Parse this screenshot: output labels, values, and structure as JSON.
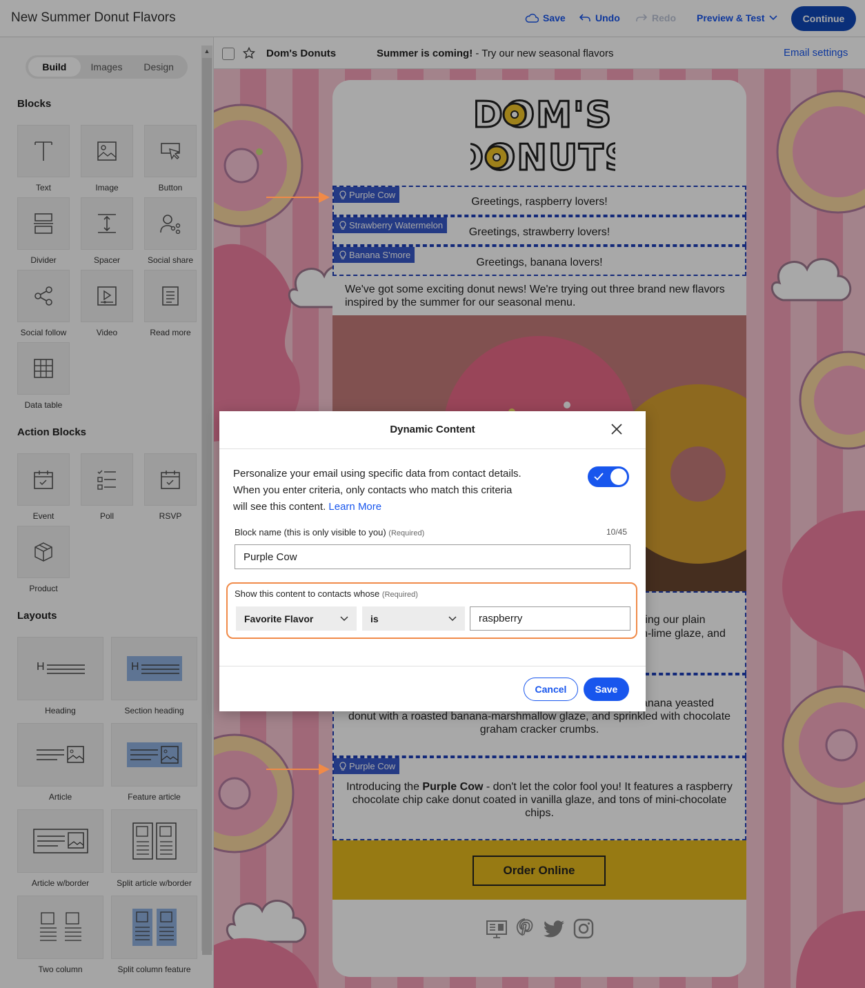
{
  "header": {
    "title": "New Summer Donut Flavors",
    "save": "Save",
    "undo": "Undo",
    "redo": "Redo",
    "preview": "Preview & Test",
    "continue": "Continue"
  },
  "sidebar": {
    "tabs": [
      "Build",
      "Images",
      "Design"
    ],
    "blocks_title": "Blocks",
    "blocks": [
      "Text",
      "Image",
      "Button",
      "Divider",
      "Spacer",
      "Social share",
      "Social follow",
      "Video",
      "Read more",
      "Data table"
    ],
    "action_title": "Action Blocks",
    "action_blocks": [
      "Event",
      "Poll",
      "RSVP",
      "Product"
    ],
    "layouts_title": "Layouts",
    "layouts": [
      "Heading",
      "Section heading",
      "Article",
      "Feature article",
      "Article w/border",
      "Split article w/border",
      "Two column",
      "Split column feature"
    ]
  },
  "subject_bar": {
    "sender": "Dom's Donuts",
    "subject_bold": "Summer is coming!",
    "subject_rest": " - Try our new seasonal flavors",
    "settings": "Email settings"
  },
  "email": {
    "logo_line1": "DOM'S",
    "logo_line2": "DONUTS",
    "greetings": [
      {
        "tag": "Purple Cow",
        "text": "Greetings, raspberry lovers!"
      },
      {
        "tag": "Strawberry Watermelon",
        "text": "Greetings, strawberry lovers!"
      },
      {
        "tag": "Banana S'more",
        "text": "Greetings, banana lovers!"
      }
    ],
    "intro": "We've got some exciting donut news! We're trying out three brand new flavors inspired by the summer for our seasonal menu.",
    "partial_line1": "ring our plain",
    "partial_line2": "n-lime glaze, and",
    "banana_desc_line1": "anana yeasted",
    "banana_desc_rest": "donut with a roasted banana-marshmallow glaze, and sprinkled with chocolate graham cracker crumbs.",
    "purple_tag": "Purple Cow",
    "purple_pre": "Introducing the ",
    "purple_bold": "Purple Cow",
    "purple_rest": " - don't let the color fool you! It features a raspberry chocolate chip cake donut coated in vanilla glaze, and tons of mini-chocolate chips.",
    "order_button": "Order Online"
  },
  "modal": {
    "title": "Dynamic Content",
    "description": "Personalize your email using specific data from contact details. When you enter criteria, only contacts who match this criteria will see this content.",
    "learn_more": "Learn More",
    "toggle_on": true,
    "name_label": "Block name (this is only visible to you)",
    "required": "(Required)",
    "char_count": "10/45",
    "name_value": "Purple Cow",
    "criteria_label": "Show this content to contacts whose",
    "field_select": "Favorite Flavor",
    "operator_select": "is",
    "value": "raspberry",
    "cancel": "Cancel",
    "save": "Save"
  },
  "colors": {
    "primary": "#1856ed",
    "continue": "#1048b8",
    "highlight": "#f08a48",
    "tag": "#3758c8",
    "order_bar": "#e6b91e"
  }
}
